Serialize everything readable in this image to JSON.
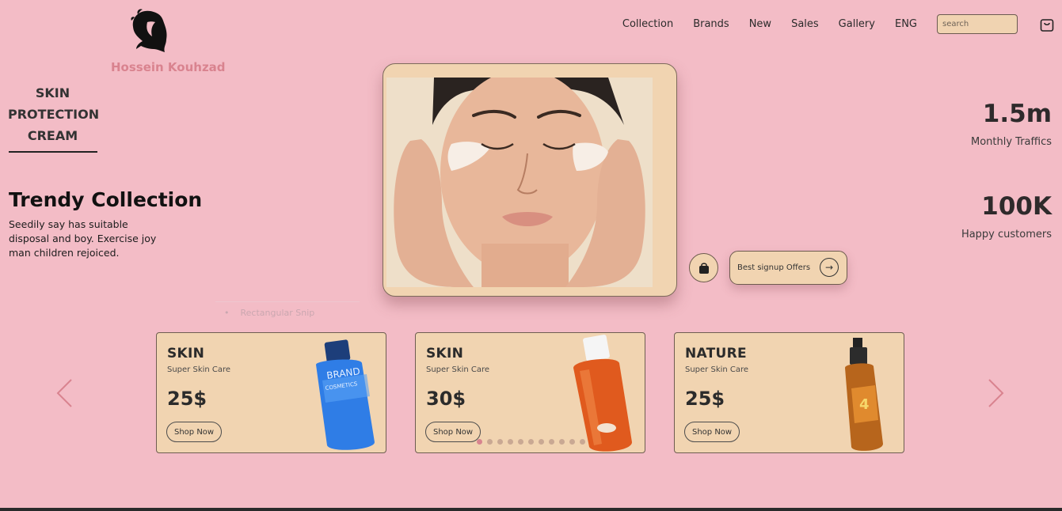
{
  "brand": {
    "name": "Hossein Kouhzad"
  },
  "nav": {
    "items": [
      "Collection",
      "Brands",
      "New",
      "Sales",
      "Gallery",
      "ENG"
    ],
    "search_placeholder": "search"
  },
  "side": {
    "title": "SKIN PROTECTION CREAM"
  },
  "intro": {
    "heading": "Trendy Collection",
    "description": "Seedily say has suitable disposal and boy. Exercise joy man children rejoiced."
  },
  "stats": [
    {
      "value": "1.5m",
      "label": "Monthly Traffics"
    },
    {
      "value": "100K",
      "label": "Happy customers"
    }
  ],
  "offer": {
    "label": "Best signup Offers"
  },
  "snip_label": "Rectangular Snip",
  "products": [
    {
      "title": "SKIN",
      "subtitle": "Super Skin Care",
      "price": "25$",
      "button": "Shop Now",
      "image": "blue-bottle"
    },
    {
      "title": "SKIN",
      "subtitle": "Super Skin Care",
      "price": "30$",
      "button": "Shop Now",
      "image": "orange-bottle"
    },
    {
      "title": "NATURE",
      "subtitle": "Super Skin Care",
      "price": "25$",
      "button": "Shop Now",
      "image": "amber-spray"
    }
  ],
  "carousel": {
    "dot_count": 11,
    "active_index": 0
  },
  "colors": {
    "background": "#f3bcc6",
    "card": "#f1d4b1",
    "accent": "#d9838f"
  }
}
